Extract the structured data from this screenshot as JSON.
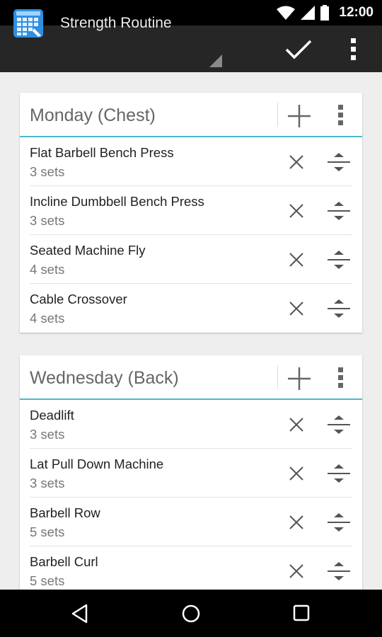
{
  "status": {
    "time": "12:00"
  },
  "toolbar": {
    "title": "Strength Routine"
  },
  "days": [
    {
      "title": "Monday (Chest)",
      "exercises": [
        {
          "name": "Flat Barbell Bench Press",
          "sets": "3 sets"
        },
        {
          "name": "Incline Dumbbell Bench Press",
          "sets": "3 sets"
        },
        {
          "name": "Seated Machine Fly",
          "sets": "4 sets"
        },
        {
          "name": "Cable Crossover",
          "sets": "4 sets"
        }
      ]
    },
    {
      "title": "Wednesday (Back)",
      "exercises": [
        {
          "name": "Deadlift",
          "sets": "3 sets"
        },
        {
          "name": "Lat Pull Down Machine",
          "sets": "3 sets"
        },
        {
          "name": "Barbell Row",
          "sets": "5 sets"
        },
        {
          "name": "Barbell Curl",
          "sets": "5 sets"
        }
      ]
    }
  ],
  "colors": {
    "accent": "#4cb8cc",
    "action_bar": "#262626",
    "background": "#eeeeee"
  }
}
